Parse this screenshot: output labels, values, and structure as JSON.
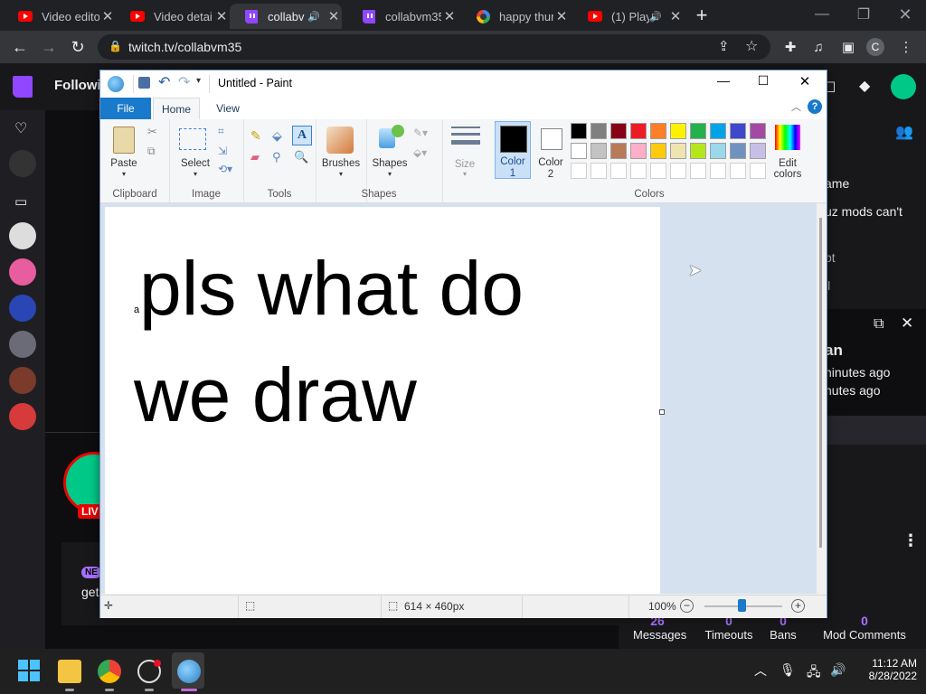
{
  "browser": {
    "tabs": [
      {
        "title": "Video edito",
        "favicon": "youtube-icon",
        "audio": false
      },
      {
        "title": "Video detai",
        "favicon": "youtube-icon",
        "audio": false
      },
      {
        "title": "collabv",
        "favicon": "twitch-icon",
        "audio": true,
        "active": true
      },
      {
        "title": "collabvm35",
        "favicon": "twitch-icon",
        "audio": false
      },
      {
        "title": "happy thun",
        "favicon": "google-icon",
        "audio": false
      },
      {
        "title": "(1) Play",
        "favicon": "youtube-icon",
        "audio": true
      }
    ],
    "new_tab": "+",
    "url": "twitch.tv/collabvm35",
    "profile_initial": "C"
  },
  "twitch": {
    "following_label": "Followin",
    "live_badge": "LIV",
    "new_badge": "NE",
    "get_text": "get",
    "chat_lines": [
      "ame",
      "uz mods can't",
      "pt",
      "ll"
    ],
    "popup_name": "an",
    "popup_line1": "ninutes ago",
    "popup_line2": "nutes ago",
    "stats": [
      {
        "value": "26",
        "label": "Messages"
      },
      {
        "value": "0",
        "label": "Timeouts"
      },
      {
        "value": "0",
        "label": "Bans"
      },
      {
        "value": "0",
        "label": "Mod Comments"
      }
    ]
  },
  "paint": {
    "title": "Untitled - Paint",
    "tabs": [
      "File",
      "Home",
      "View"
    ],
    "groups": {
      "clipboard": "Clipboard",
      "image": "Image",
      "tools": "Tools",
      "shapes": "Shapes",
      "colors": "Colors"
    },
    "buttons": {
      "paste": "Paste",
      "select": "Select",
      "brushes": "Brushes",
      "shapes": "Shapes",
      "size": "Size",
      "color1_a": "Color",
      "color1_b": "1",
      "color2_a": "Color",
      "color2_b": "2",
      "edit_colors_a": "Edit",
      "edit_colors_b": "colors"
    },
    "palette": [
      "#000000",
      "#7f7f7f",
      "#880015",
      "#ed1c24",
      "#ff7f27",
      "#fff200",
      "#22b14c",
      "#00a2e8",
      "#3f48cc",
      "#a349a4",
      "#ffffff",
      "#c3c3c3",
      "#b97a57",
      "#ffaec9",
      "#ffc90e",
      "#efe4b0",
      "#b5e61d",
      "#99d9ea",
      "#7092be",
      "#c8bfe7"
    ],
    "color1": "#000000",
    "color2": "#ffffff",
    "canvas_small_char": "a",
    "canvas_line1": "pls what do",
    "canvas_line2": "we draw",
    "status_size": "614 × 460px",
    "zoom": "100%"
  },
  "taskbar": {
    "time": "11:12 AM",
    "date": "8/28/2022"
  }
}
